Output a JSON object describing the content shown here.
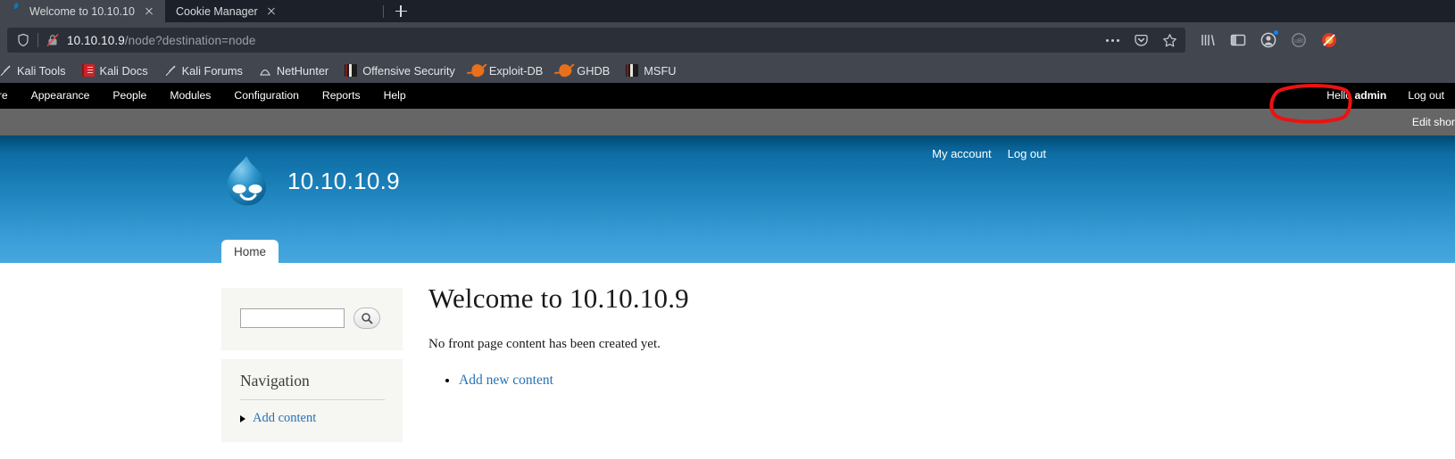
{
  "browser": {
    "tabs": [
      {
        "title": "Welcome to 10.10.10.9 |",
        "favicon": "druplicon-icon",
        "active": true
      },
      {
        "title": "Cookie Manager",
        "favicon": "none",
        "active": false
      }
    ],
    "new_tab_label": "+",
    "url": {
      "host": "10.10.10.9",
      "path": "/node?destination=node",
      "shield_icon": "shield-icon",
      "insecure_icon": "broken-lock-icon"
    },
    "urlbar_buttons": [
      {
        "name": "page-actions-ellipsis",
        "label": "•••"
      },
      {
        "name": "pocket-icon",
        "label": ""
      },
      {
        "name": "bookmark-star-icon",
        "label": ""
      }
    ],
    "toolbar_icons": [
      {
        "name": "library-icon"
      },
      {
        "name": "sidebar-toggle-icon"
      },
      {
        "name": "account-icon",
        "badge": true
      },
      {
        "name": "extension-icon"
      },
      {
        "name": "blocker-icon"
      }
    ],
    "bookmarks": [
      {
        "label": "Kali Tools",
        "icon": "kali-tool-icon"
      },
      {
        "label": "Kali Docs",
        "icon": "red-book-icon"
      },
      {
        "label": "Kali Forums",
        "icon": "kali-tool-icon"
      },
      {
        "label": "NetHunter",
        "icon": "nethunter-icon"
      },
      {
        "label": "Offensive Security",
        "icon": "offsec-icon"
      },
      {
        "label": "Exploit-DB",
        "icon": "bug-icon"
      },
      {
        "label": "GHDB",
        "icon": "bug-icon"
      },
      {
        "label": "MSFU",
        "icon": "msfu-icon"
      }
    ]
  },
  "admin_toolbar": {
    "items": [
      {
        "label": "ure"
      },
      {
        "label": "Appearance"
      },
      {
        "label": "People"
      },
      {
        "label": "Modules"
      },
      {
        "label": "Configuration"
      },
      {
        "label": "Reports"
      },
      {
        "label": "Help"
      }
    ],
    "greeting_prefix": "Hello ",
    "username": "admin",
    "logout_label": "Log out",
    "shortcut_label": "Edit shor",
    "annotation_color": "#ee1111"
  },
  "site": {
    "name": "10.10.10.9",
    "logo_icon": "druplicon-icon",
    "user_links": [
      {
        "label": "My account"
      },
      {
        "label": "Log out"
      }
    ],
    "primary_tabs": [
      {
        "label": "Home",
        "active": true
      }
    ],
    "sidebar": {
      "search": {
        "value": "",
        "placeholder": "",
        "button_icon": "search-icon"
      },
      "navigation": {
        "title": "Navigation",
        "items": [
          {
            "label": "Add content",
            "bullet": "caret-right-icon"
          }
        ]
      }
    },
    "content": {
      "title": "Welcome to 10.10.10.9",
      "paragraph": "No front page content has been created yet.",
      "links": [
        {
          "label": "Add new content"
        }
      ]
    }
  }
}
